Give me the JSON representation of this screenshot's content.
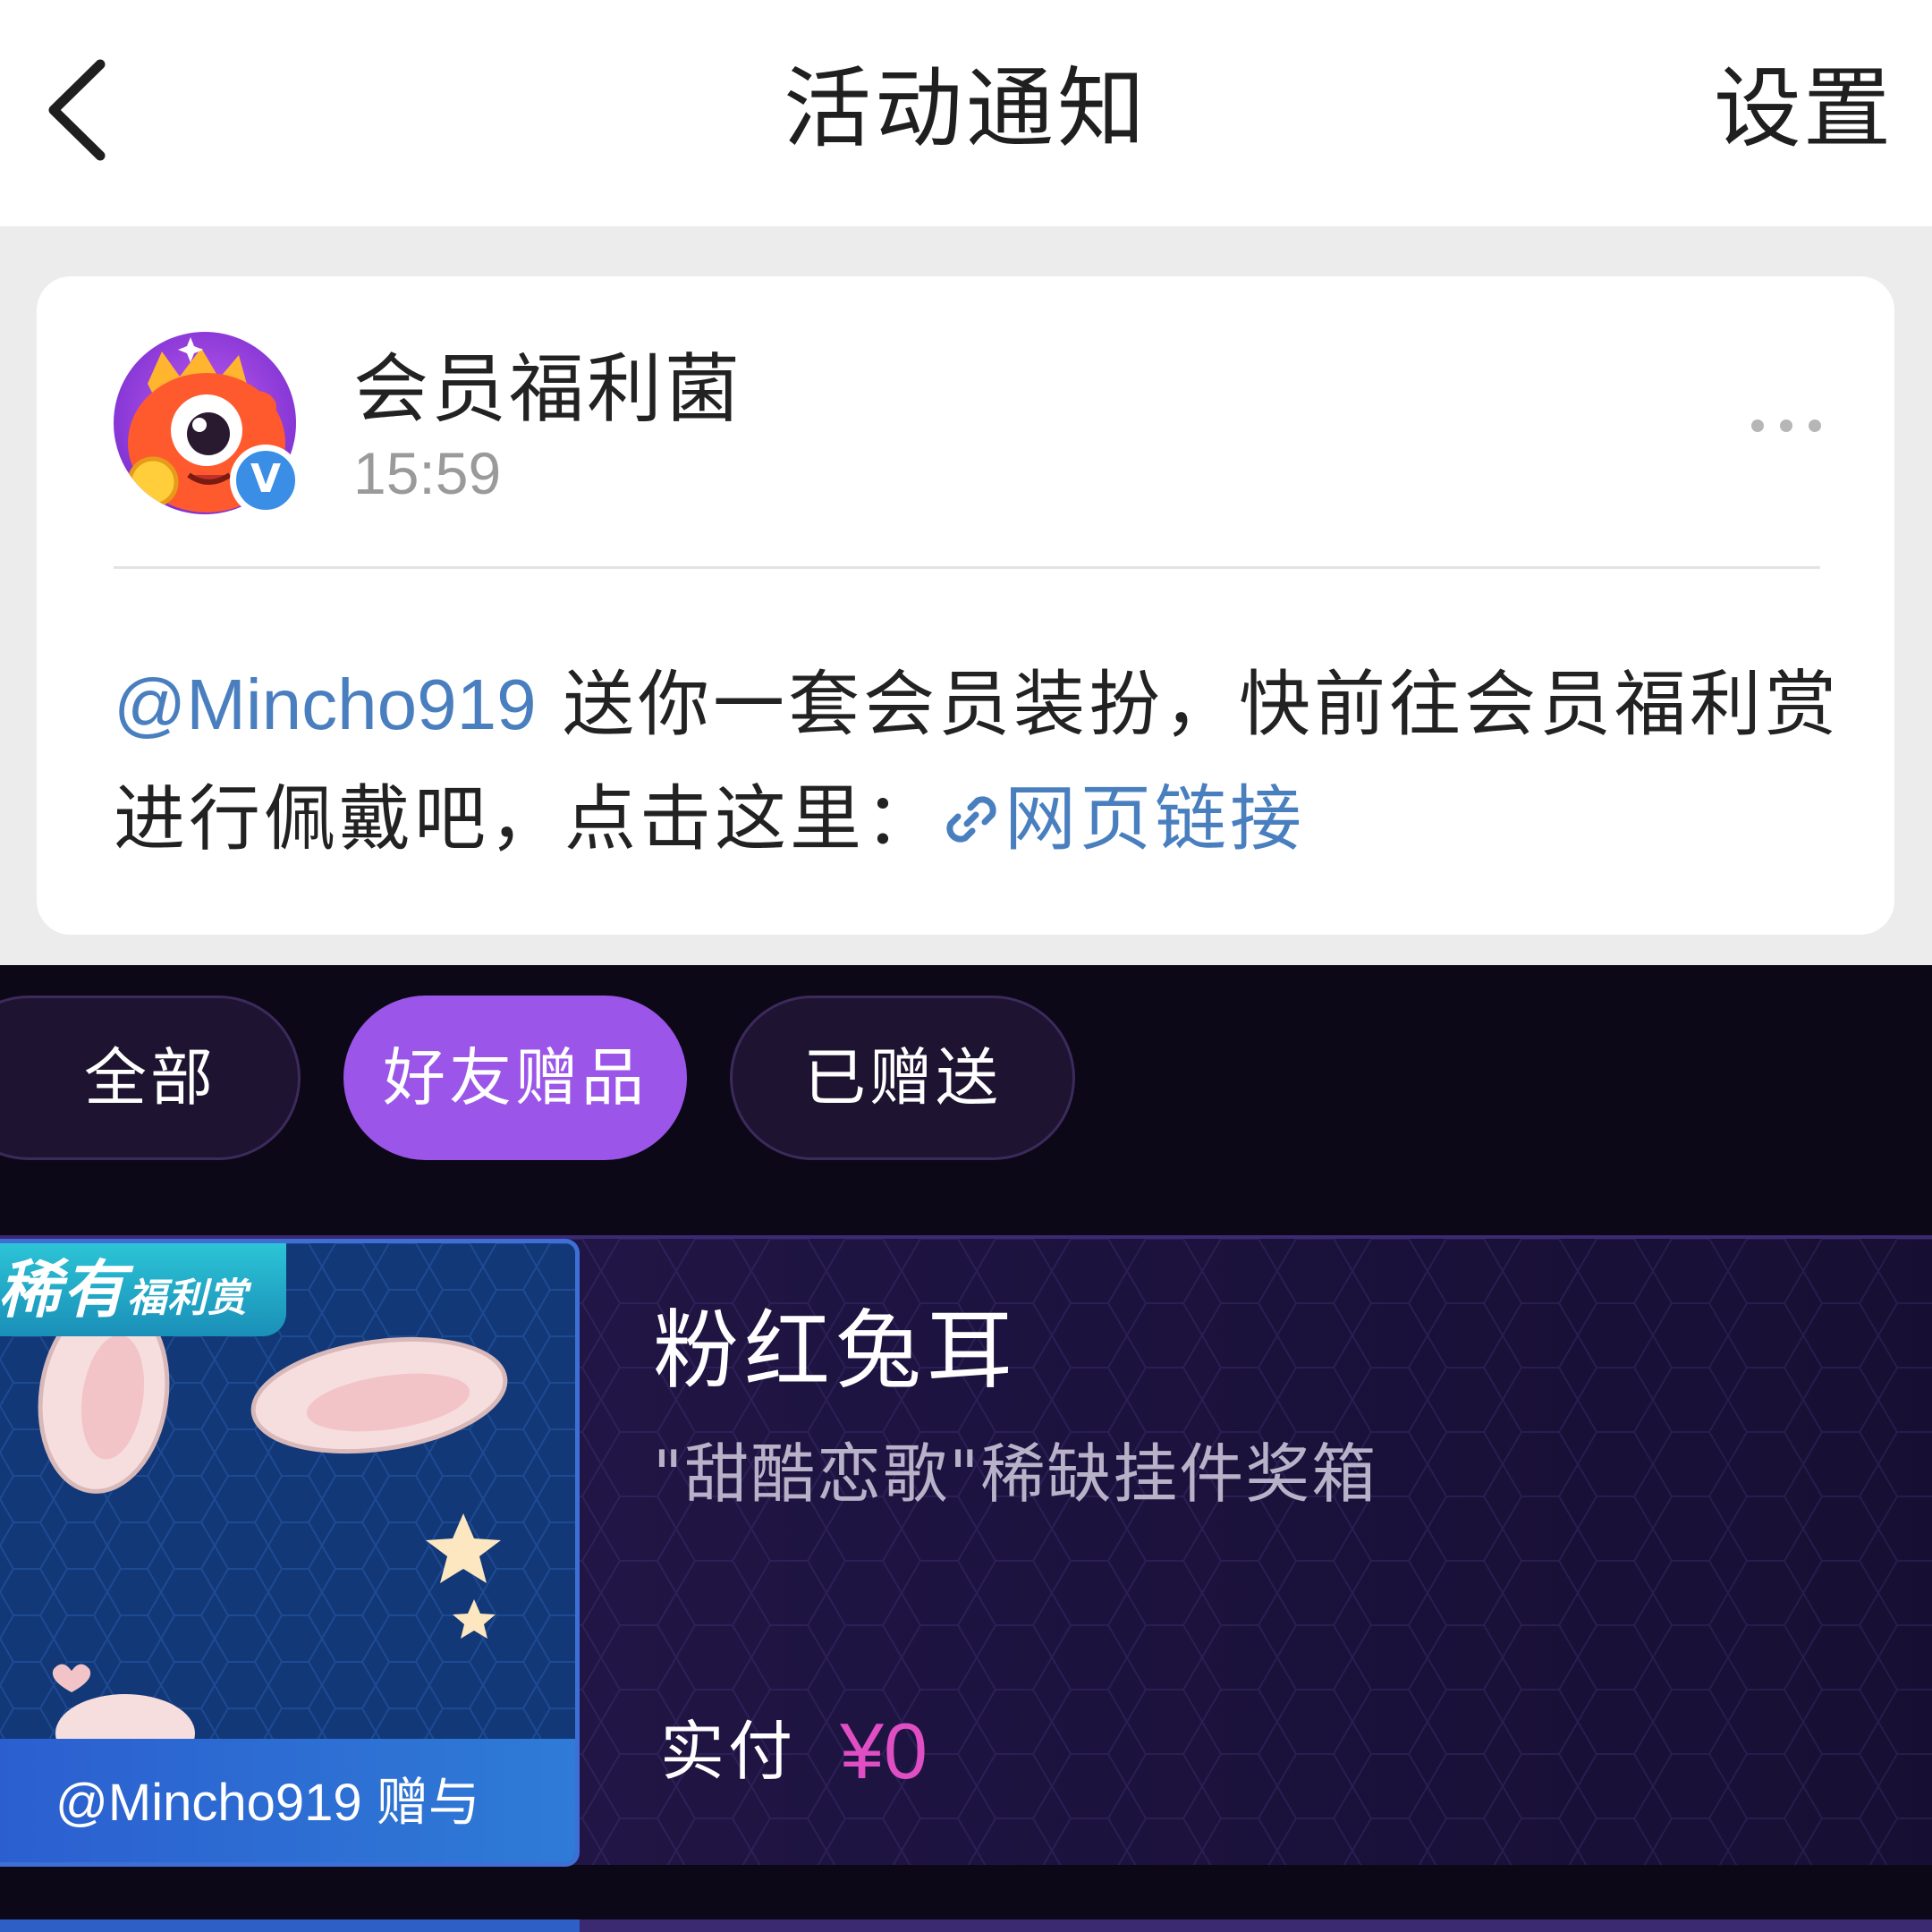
{
  "header": {
    "back_icon": "chevron-left-icon",
    "title": "活动通知",
    "settings_label": "设置"
  },
  "notice": {
    "sender_name": "会员福利菌",
    "time": "15:59",
    "avatar_icon": "monster-mascot-avatar",
    "verified_badge": "V",
    "more_icon": "more-dots-icon",
    "body": {
      "mention": "@Mincho919",
      "text": " 送你一套会员装扮，快前往会员福利赏进行佩戴吧，点击这里：",
      "link_icon": "link-icon",
      "link_label": "网页链接"
    }
  },
  "gift_tabs": [
    {
      "label": "全部",
      "selected": false
    },
    {
      "label": "好友赠品",
      "selected": true
    },
    {
      "label": "已赠送",
      "selected": false
    }
  ],
  "gift_item": {
    "badge_main": "稀有",
    "badge_sub": "福利赏",
    "image_icon": "bunny-ears-icon",
    "giver_text": "@Mincho919 赠与",
    "name": "粉红兔耳",
    "description": "\"甜酷恋歌\"稀缺挂件奖箱",
    "price_label": "实付",
    "price_value": "¥0"
  },
  "colors": {
    "accent_purple": "#9b55e8",
    "link_blue": "#4a7fbf",
    "price_pink": "#e04ec4",
    "dark_bg": "#0c0818"
  }
}
